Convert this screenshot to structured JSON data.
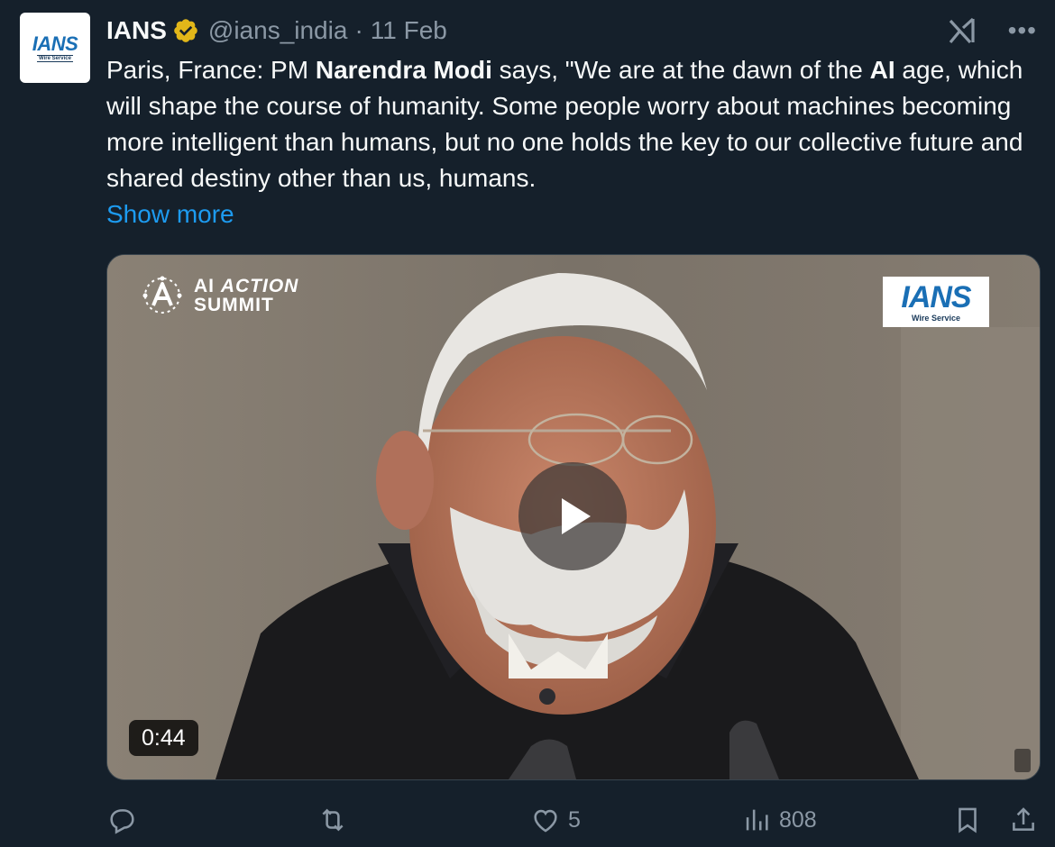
{
  "author": {
    "display_name": "IANS",
    "handle": "@ians_india",
    "separator": "·",
    "date": "11 Feb",
    "avatar_text": "IANS",
    "avatar_subtext": "Wire Service"
  },
  "tweet": {
    "text_parts": [
      "Paris, France: PM ",
      "Narendra Modi",
      " says, \"We are at the dawn of the ",
      "AI",
      " age, which will shape the course of humanity. Some people worry about machines becoming more intelligent than humans, but no one holds the key to our collective future and shared destiny other than us, humans."
    ],
    "show_more": "Show more"
  },
  "media": {
    "summit_line1_a": "AI",
    "summit_line1_b": "ACTION",
    "summit_line2": "SUMMIT",
    "watermark_text": "IANS",
    "watermark_subtext": "Wire Service",
    "duration": "0:44"
  },
  "actions": {
    "replies": "",
    "reposts": "",
    "likes": "5",
    "views": "808"
  },
  "icons": {
    "verified": "verified-gold-badge-icon",
    "grok": "grok-icon",
    "more": "more-icon",
    "reply": "reply-icon",
    "repost": "repost-icon",
    "like": "like-icon",
    "views": "views-icon",
    "bookmark": "bookmark-icon",
    "share": "share-icon",
    "play": "play-icon"
  },
  "colors": {
    "background": "#15202b",
    "link": "#1d9bf0",
    "muted": "#8b98a5",
    "verified": "#e2b719"
  }
}
